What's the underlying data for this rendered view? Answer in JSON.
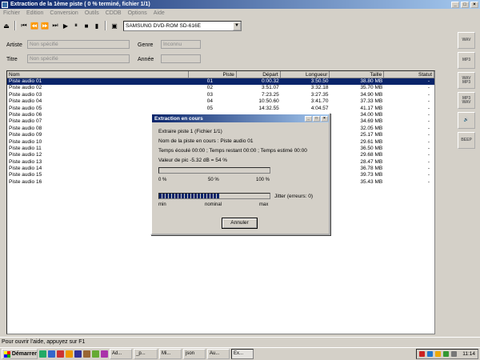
{
  "window": {
    "title": "Extraction de la 1ème piste ( 0 % terminé, fichier 1/1)"
  },
  "menu": [
    "Fichier",
    "Edition",
    "Conversion",
    "Outils",
    "CDDB",
    "Options",
    "Aide"
  ],
  "toolbar": {
    "drive": "SAMSUNG DVD-ROM SD-616E"
  },
  "metadata": {
    "artist_label": "Artiste",
    "artist_value": "Non spécifié",
    "title_label": "Titre",
    "title_value": "Non spécifié",
    "genre_label": "Genre",
    "genre_value": "Inconnu",
    "year_label": "Année",
    "year_value": ""
  },
  "table": {
    "columns": [
      "Nom",
      "Piste",
      "Départ",
      "Longueur",
      "Taille",
      "Statut"
    ],
    "rows": [
      [
        "Piste audio 01",
        "01",
        "0:00.32",
        "3:50.50",
        "38.80 MB",
        "-"
      ],
      [
        "Piste audio 02",
        "02",
        "3:51.07",
        "3:32.18",
        "35.70 MB",
        "-"
      ],
      [
        "Piste audio 03",
        "03",
        "7:23.25",
        "3:27.35",
        "34.90 MB",
        "-"
      ],
      [
        "Piste audio 04",
        "04",
        "10:50.60",
        "3:41.70",
        "37.33 MB",
        "-"
      ],
      [
        "Piste audio 05",
        "05",
        "14:32.55",
        "4:04.57",
        "41.17 MB",
        "-"
      ],
      [
        "Piste audio 06",
        "",
        "",
        "",
        "34.00 MB",
        "-"
      ],
      [
        "Piste audio 07",
        "",
        "",
        "",
        "34.69 MB",
        "-"
      ],
      [
        "Piste audio 08",
        "",
        "",
        "",
        "32.05 MB",
        "-"
      ],
      [
        "Piste audio 09",
        "",
        "",
        "",
        "25.17 MB",
        "-"
      ],
      [
        "Piste audio 10",
        "",
        "",
        "",
        "29.61 MB",
        "-"
      ],
      [
        "Piste audio 11",
        "",
        "",
        "",
        "36.50 MB",
        "-"
      ],
      [
        "Piste audio 12",
        "",
        "",
        "",
        "29.68 MB",
        "-"
      ],
      [
        "Piste audio 13",
        "",
        "",
        "",
        "28.47 MB",
        "-"
      ],
      [
        "Piste audio 14",
        "",
        "",
        "",
        "36.78 MB",
        "-"
      ],
      [
        "Piste audio 15",
        "",
        "",
        "",
        "39.73 MB",
        "-"
      ],
      [
        "Piste audio 16",
        "",
        "",
        "",
        "35.43 MB",
        "-"
      ]
    ]
  },
  "side_tools": [
    "WAV",
    "MP3",
    "WAV MP3",
    "MP3 WAV",
    "",
    "BEEP"
  ],
  "dialog": {
    "title": "Extraction en cours",
    "line1": "Extraire piste 1  (Fichier 1/1)",
    "line2": "Nom de la piste en cours : Piste audio 01",
    "line3": "Temps écoulé 00:00 ; Temps restant 00:00 ; Temps estimé 00:00",
    "line4": "Valeur de pic -5.32 dB = 54 %",
    "progress_fraction": 0,
    "scale1": [
      "0 %",
      "50 %",
      "100 %"
    ],
    "jitter_fraction": 0.55,
    "jitter_label": "Jitter (erreurs: 0)",
    "scale2": [
      "min",
      "nominal",
      "max"
    ],
    "cancel": "Annuler"
  },
  "statusbar": "Pour ouvrir l'aide, appuyez sur F1",
  "taskbar": {
    "start": "Démarrer",
    "tasks": [
      "Ad...",
      "_p...",
      "Mi...",
      "json",
      "Au...",
      "Ex..."
    ],
    "clock": "11:14"
  }
}
